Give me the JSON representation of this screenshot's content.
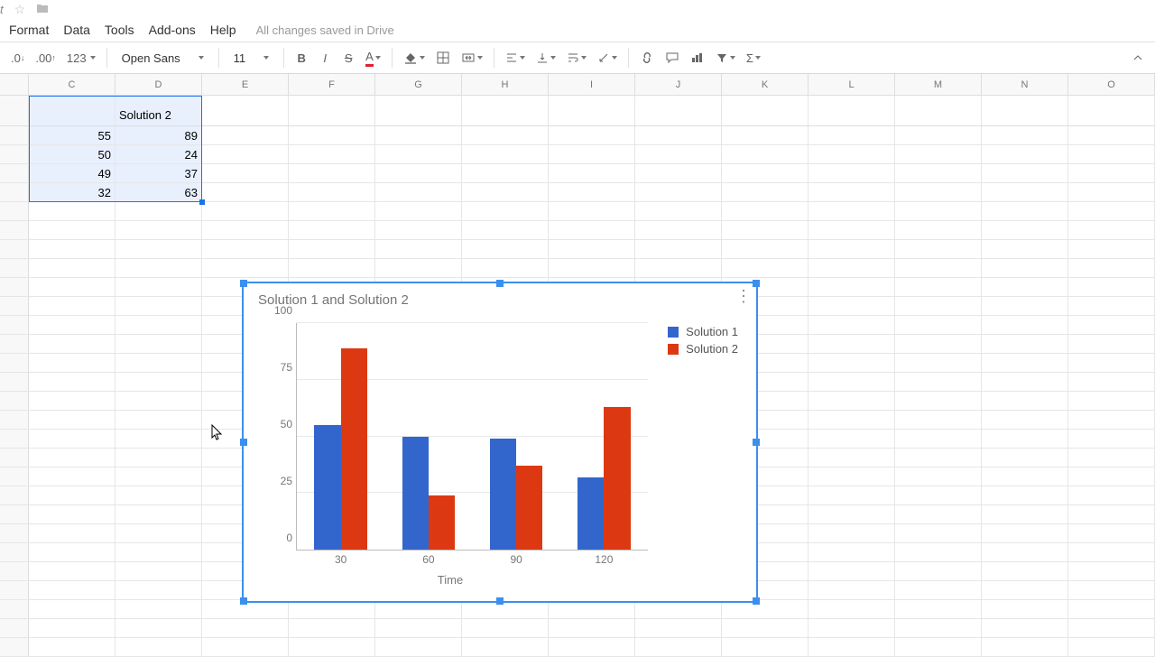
{
  "titlebar": {
    "doc_suffix": "t"
  },
  "menu": {
    "format": "Format",
    "data": "Data",
    "tools": "Tools",
    "addons": "Add-ons",
    "help": "Help",
    "saved": "All changes saved in Drive"
  },
  "toolbar": {
    "dec0": ".0",
    "dec00": ".00",
    "num_format": "123",
    "font": "Open Sans",
    "size": "11"
  },
  "columns": [
    "C",
    "D",
    "E",
    "F",
    "G",
    "H",
    "I",
    "J",
    "K",
    "L",
    "M",
    "N",
    "O"
  ],
  "table": {
    "header_d": "Solution 2",
    "rows": [
      {
        "c": "55",
        "d": "89"
      },
      {
        "c": "50",
        "d": "24"
      },
      {
        "c": "49",
        "d": "37"
      },
      {
        "c": "32",
        "d": "63"
      }
    ]
  },
  "chart_ui": {
    "title": "Solution 1 and Solution 2",
    "legend1": "Solution 1",
    "legend2": "Solution 2",
    "xlabel": "Time",
    "yticks": [
      "0",
      "25",
      "50",
      "75",
      "100"
    ],
    "xticks": [
      "30",
      "60",
      "90",
      "120"
    ]
  },
  "chart_data": {
    "type": "bar",
    "title": "Solution 1 and Solution 2",
    "xlabel": "Time",
    "ylabel": "",
    "ylim": [
      0,
      100
    ],
    "categories": [
      30,
      60,
      90,
      120
    ],
    "series": [
      {
        "name": "Solution 1",
        "color": "#3366cc",
        "values": [
          55,
          50,
          49,
          32
        ]
      },
      {
        "name": "Solution 2",
        "color": "#dc3912",
        "values": [
          89,
          24,
          37,
          63
        ]
      }
    ]
  }
}
